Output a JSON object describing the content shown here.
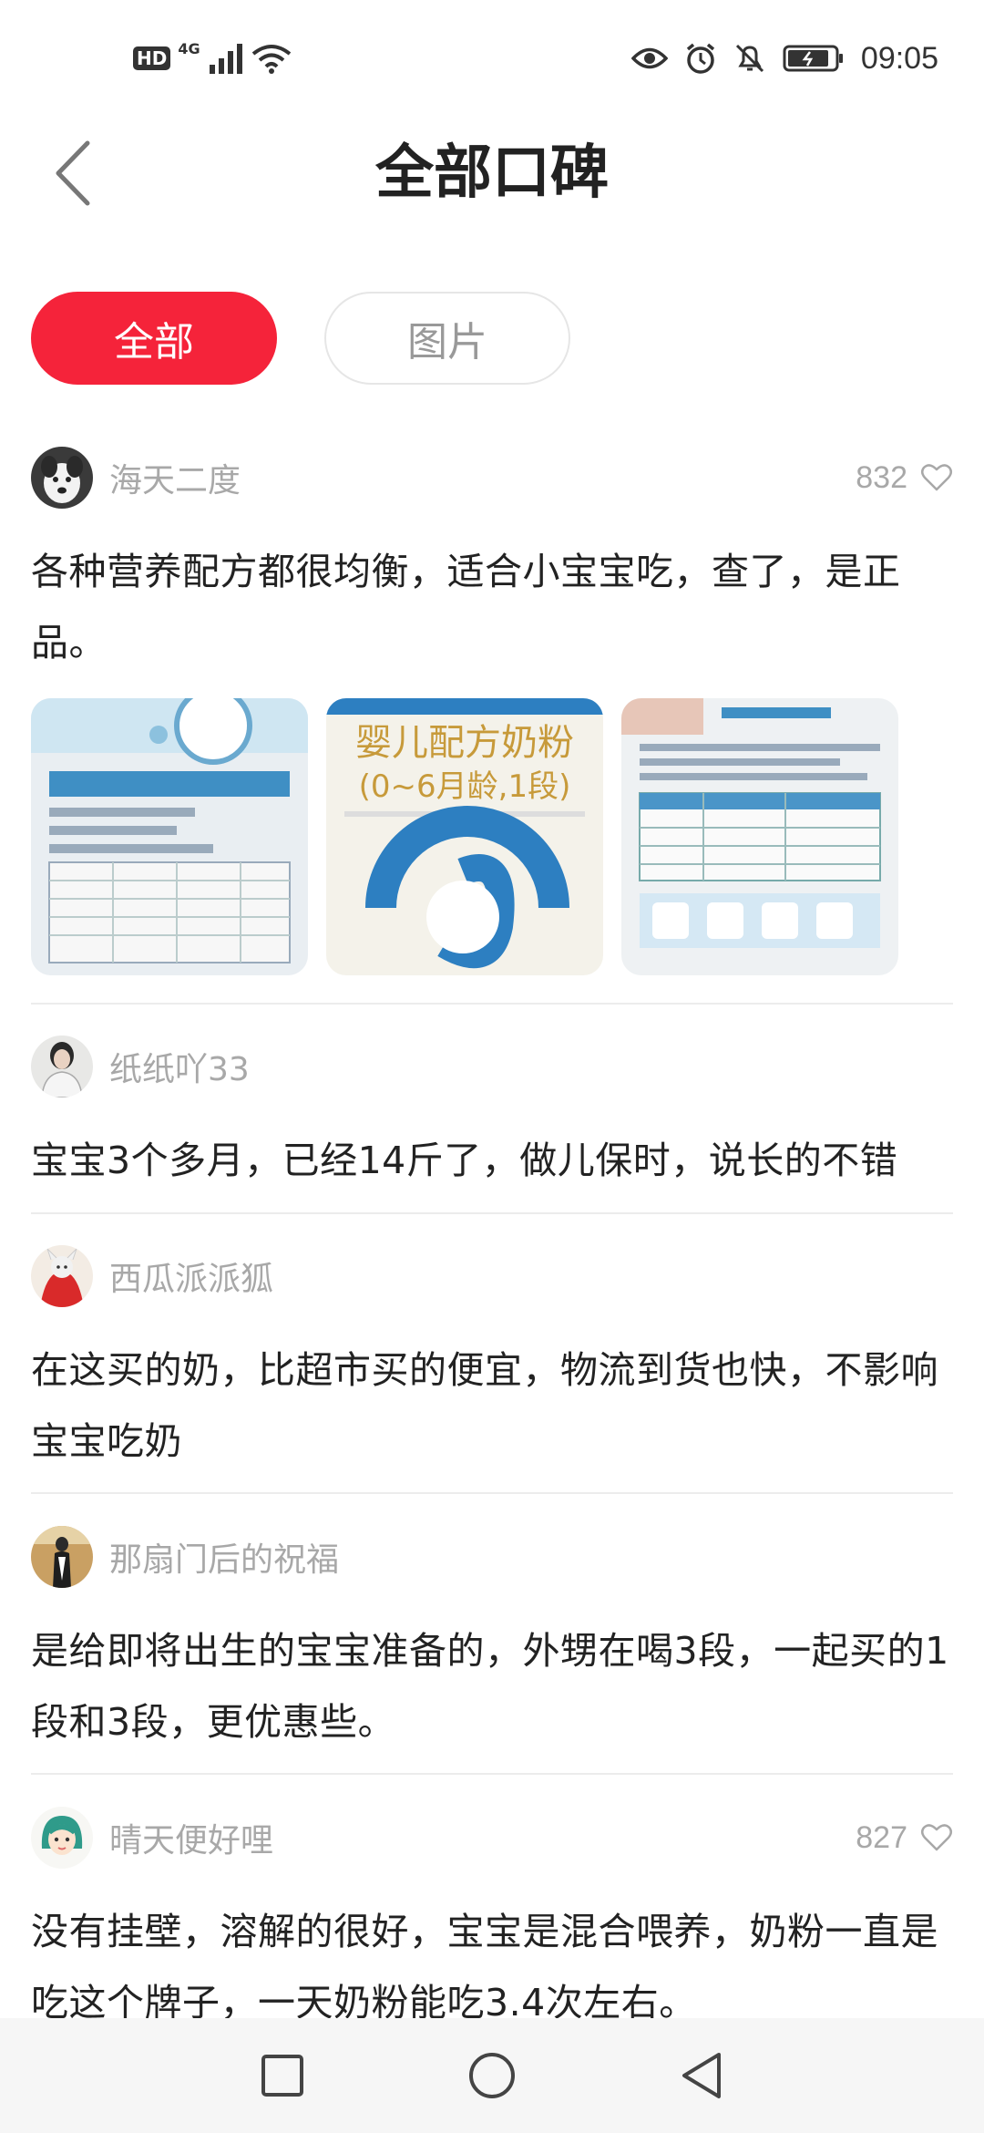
{
  "status_bar": {
    "hd": "HD",
    "network": "4G",
    "time": "09:05",
    "icons": [
      "signal-icon",
      "wifi-icon",
      "eye-icon",
      "alarm-icon",
      "mute-icon",
      "battery-icon"
    ]
  },
  "header": {
    "title": "全部口碑",
    "back_icon": "chevron-left-icon"
  },
  "tabs": [
    {
      "label": "全部",
      "active": true
    },
    {
      "label": "图片",
      "active": false
    }
  ],
  "reviews": [
    {
      "user": "海天二度",
      "likes": "832",
      "text": "各种营养配方都很均衡，适合小宝宝吃，查了，是正品。",
      "photos": [
        {
          "caption": ""
        },
        {
          "caption": "婴儿配方奶粉",
          "caption2": "(0~6月龄,1段)"
        },
        {
          "caption": ""
        }
      ]
    },
    {
      "user": "纸纸吖33",
      "text": "宝宝3个多月，已经14斤了，做儿保时，说长的不错"
    },
    {
      "user": "西瓜派派狐",
      "text": "在这买的奶，比超市买的便宜，物流到货也快，不影响宝宝吃奶"
    },
    {
      "user": "那扇门后的祝福",
      "text": "是给即将出生的宝宝准备的，外甥在喝3段，一起买的1段和3段，更优惠些。"
    },
    {
      "user": "晴天便好哩",
      "likes": "827",
      "text": "没有挂壁，溶解的很好，宝宝是混合喂养，奶粉一直是吃这个牌子，一天奶粉能吃3.4次左右。"
    }
  ],
  "colors": {
    "accent": "#f5233a",
    "muted_text": "#a8a8a8",
    "body_text": "#222222",
    "divider": "#ececec"
  }
}
